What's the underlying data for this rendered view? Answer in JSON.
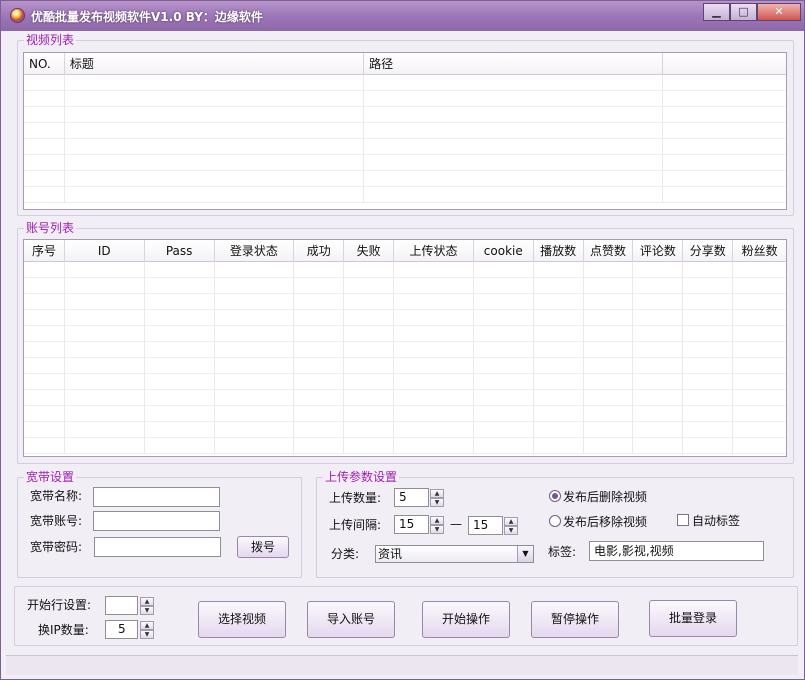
{
  "window": {
    "title": "优酷批量发布视频软件V1.0 BY：边缘软件",
    "min_glyph": "▁",
    "max_glyph": "□",
    "close_glyph": "✕",
    "accent_color": "#a01eb5"
  },
  "video_list": {
    "group_label": "视频列表",
    "columns": [
      "NO.",
      "标题",
      "路径",
      ""
    ]
  },
  "account_list": {
    "group_label": "账号列表",
    "columns": [
      "序号",
      "ID",
      "Pass",
      "登录状态",
      "成功",
      "失败",
      "上传状态",
      "cookie",
      "播放数",
      "点赞数",
      "评论数",
      "分享数",
      "粉丝数"
    ]
  },
  "broadband": {
    "group_label": "宽带设置",
    "name_label": "宽带名称:",
    "name_value": "",
    "account_label": "宽带账号:",
    "account_value": "",
    "password_label": "宽带密码:",
    "password_value": "",
    "dial_button": "拨号"
  },
  "upload_params": {
    "group_label": "上传参数设置",
    "count_label": "上传数量:",
    "count_value": "5",
    "interval_label": "上传间隔:",
    "interval_min": "15",
    "interval_dash": "—",
    "interval_max": "15",
    "category_label": "分类:",
    "category_value": "资讯",
    "radio_delete": "发布后删除视频",
    "radio_move": "发布后移除视频",
    "auto_tag_label": "自动标签",
    "tags_label": "标签:",
    "tags_value": "电影,影视,视频"
  },
  "bottom": {
    "start_row_label": "开始行设置:",
    "start_row_value": "",
    "ip_count_label": "换IP数量:",
    "ip_count_value": "5",
    "btn_select_video": "选择视频",
    "btn_import_account": "导入账号",
    "btn_start": "开始操作",
    "btn_pause": "暂停操作",
    "btn_batch_login": "批量登录"
  }
}
